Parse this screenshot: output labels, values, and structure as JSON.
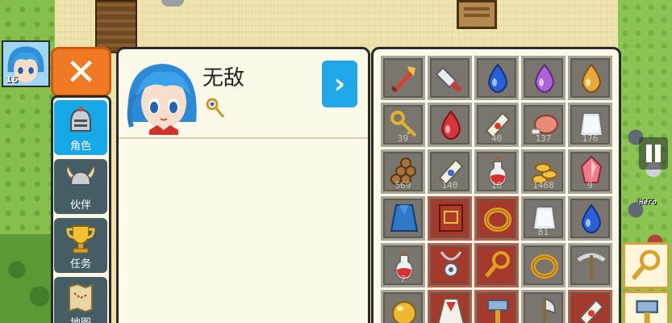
{
  "hero": {
    "level": "16"
  },
  "menu": {
    "close_icon": "✕",
    "items": [
      {
        "label": "角色",
        "icon": "knight-helmet-icon",
        "active": true
      },
      {
        "label": "伙伴",
        "icon": "horned-helmet-icon",
        "active": false
      },
      {
        "label": "任务",
        "icon": "trophy-icon",
        "active": false
      },
      {
        "label": "地图",
        "icon": "map-scroll-icon",
        "active": false
      }
    ]
  },
  "character": {
    "name": "无敌",
    "status_icon": "golden-staff-icon",
    "next_icon": "›"
  },
  "world": {
    "hero_tag": "Hero"
  },
  "inventory": {
    "slots": [
      {
        "icon": "fire-sword-icon",
        "qty": ""
      },
      {
        "icon": "drill-icon",
        "qty": ""
      },
      {
        "icon": "blue-gem-icon",
        "qty": ""
      },
      {
        "icon": "purple-gem-icon",
        "qty": ""
      },
      {
        "icon": "yellow-gem-icon",
        "qty": ""
      },
      {
        "icon": "gold-key-icon",
        "qty": "39"
      },
      {
        "icon": "red-gem-icon",
        "qty": ""
      },
      {
        "icon": "red-scroll-icon",
        "qty": "40"
      },
      {
        "icon": "meat-icon",
        "qty": "137"
      },
      {
        "icon": "silver-ingot-icon",
        "qty": "176"
      },
      {
        "icon": "wood-logs-icon",
        "qty": "569"
      },
      {
        "icon": "blue-scroll-icon",
        "qty": "140"
      },
      {
        "icon": "red-potion-icon",
        "qty": "18"
      },
      {
        "icon": "gold-coins-icon",
        "qty": "1468"
      },
      {
        "icon": "pink-crystal-icon",
        "qty": "9"
      },
      {
        "icon": "blue-cape-icon",
        "qty": ""
      },
      {
        "icon": "spellbook-icon",
        "qty": "",
        "equipped": true
      },
      {
        "icon": "gold-ring-icon",
        "qty": "",
        "equipped": true
      },
      {
        "icon": "silver-ingot-icon",
        "qty": "81"
      },
      {
        "icon": "blue-gem-icon",
        "qty": ""
      },
      {
        "icon": "red-potion-icon",
        "qty": "7"
      },
      {
        "icon": "silver-amulet-icon",
        "qty": "",
        "equipped": true
      },
      {
        "icon": "magnifier-staff-icon",
        "qty": "",
        "equipped": true
      },
      {
        "icon": "gold-ring-icon",
        "qty": ""
      },
      {
        "icon": "pickaxe-icon",
        "qty": ""
      },
      {
        "icon": "gold-orb-icon",
        "qty": ""
      },
      {
        "icon": "red-robe-icon",
        "qty": "",
        "equipped": true
      },
      {
        "icon": "hammer-icon",
        "qty": "",
        "equipped": true
      },
      {
        "icon": "axe-icon",
        "qty": ""
      },
      {
        "icon": "red-scroll-icon",
        "qty": "",
        "equipped": true
      }
    ]
  }
}
